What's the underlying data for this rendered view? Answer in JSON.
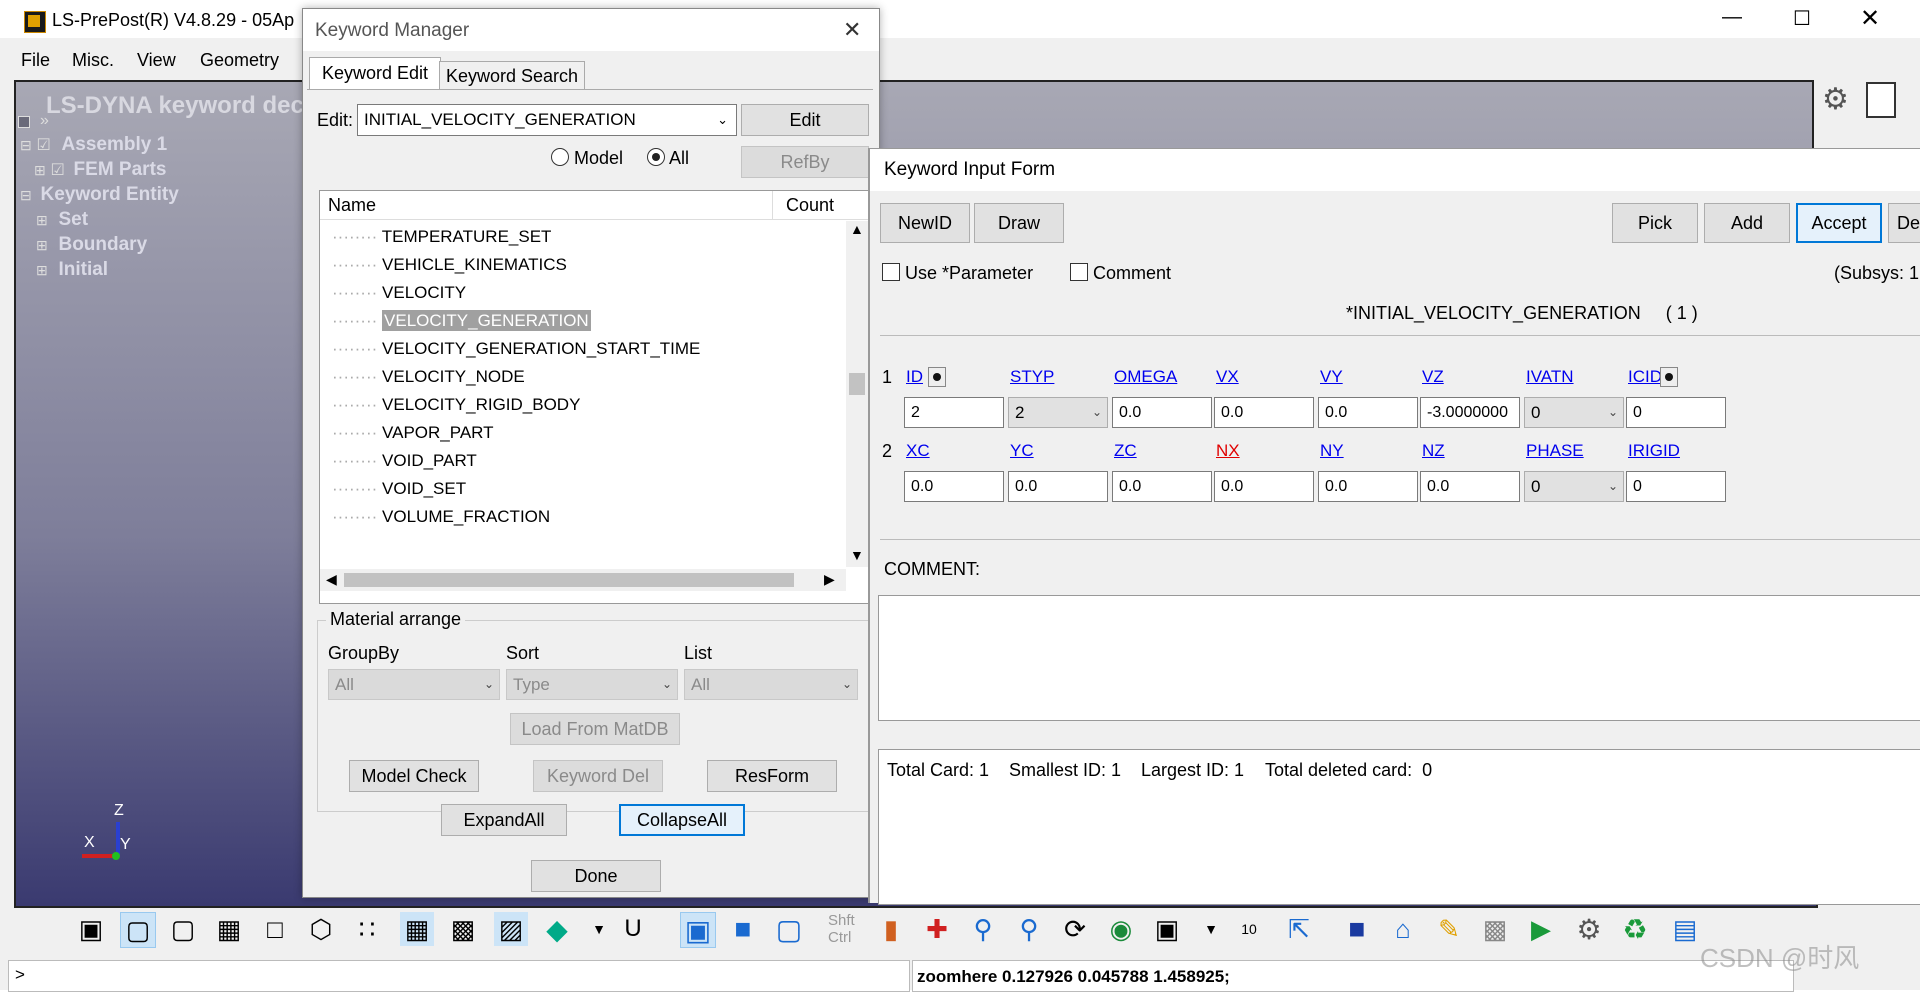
{
  "app": {
    "title": "LS-PrePost(R) V4.8.29 - 05Ap",
    "menu": [
      "File",
      "Misc.",
      "View",
      "Geometry"
    ],
    "viewport_title": "LS-DYNA keyword dec",
    "tree": {
      "assembly": "Assembly 1",
      "fem_parts": "FEM Parts",
      "keyword_entity": "Keyword Entity",
      "set": "Set",
      "boundary": "Boundary",
      "initial": "Initial"
    },
    "axis": {
      "z": "Z",
      "x": "X",
      "y": "Y"
    },
    "cmd_prompt": ">",
    "cmd_output": "zoomhere 0.127926 0.045788 1.458925;",
    "toolbar_text": {
      "shift": "Shft",
      "ctrl": "Ctrl",
      "num": "10",
      "u": "U"
    },
    "watermark": "CSDN @时风"
  },
  "keyword_manager": {
    "title": "Keyword Manager",
    "tabs": [
      "Keyword Edit",
      "Keyword Search"
    ],
    "edit_label": "Edit:",
    "edit_value": "INITIAL_VELOCITY_GENERATION",
    "edit_button": "Edit",
    "radio_model": "Model",
    "radio_all": "All",
    "refby_button": "RefBy",
    "col_name": "Name",
    "col_count": "Count",
    "items": [
      "TEMPERATURE_SET",
      "VEHICLE_KINEMATICS",
      "VELOCITY",
      "VELOCITY_GENERATION",
      "VELOCITY_GENERATION_START_TIME",
      "VELOCITY_NODE",
      "VELOCITY_RIGID_BODY",
      "VAPOR_PART",
      "VOID_PART",
      "VOID_SET",
      "VOLUME_FRACTION"
    ],
    "selected_index": 3,
    "material_arrange": "Material arrange",
    "groupby_label": "GroupBy",
    "sort_label": "Sort",
    "list_label": "List",
    "groupby_value": "All",
    "sort_value": "Type",
    "list_value": "All",
    "load_from_matdb": "Load From MatDB",
    "model_check": "Model Check",
    "keyword_del": "Keyword Del",
    "resform": "ResForm",
    "expand_all": "ExpandAll",
    "collapse_all": "CollapseAll",
    "done": "Done"
  },
  "input_form": {
    "title": "Keyword Input Form",
    "newid": "NewID",
    "draw": "Draw",
    "pick": "Pick",
    "add": "Add",
    "accept": "Accept",
    "del_partial": "De",
    "use_parameter": "Use *Parameter",
    "comment_check": "Comment",
    "subsys": "(Subsys: 1",
    "keyword_title": "*INITIAL_VELOCITY_GENERATION",
    "keyword_index": "( 1 )",
    "row1_num": "1",
    "row2_num": "2",
    "card1_labels": [
      "ID",
      "STYP",
      "OMEGA",
      "VX",
      "VY",
      "VZ",
      "IVATN",
      "ICID"
    ],
    "card1_values": [
      "2",
      "2",
      "0.0",
      "0.0",
      "0.0",
      "-3.0000000",
      "0",
      "0"
    ],
    "card2_labels": [
      "XC",
      "YC",
      "ZC",
      "NX",
      "NY",
      "NZ",
      "PHASE",
      "IRIGID"
    ],
    "card2_values": [
      "0.0",
      "0.0",
      "0.0",
      "0.0",
      "0.0",
      "0.0",
      "0",
      "0"
    ],
    "comment_label": "COMMENT:",
    "status": {
      "total_card": "Total Card: 1",
      "smallest_id": "Smallest ID: 1",
      "largest_id": "Largest ID: 1",
      "total_deleted": "Total deleted card:  0"
    }
  }
}
